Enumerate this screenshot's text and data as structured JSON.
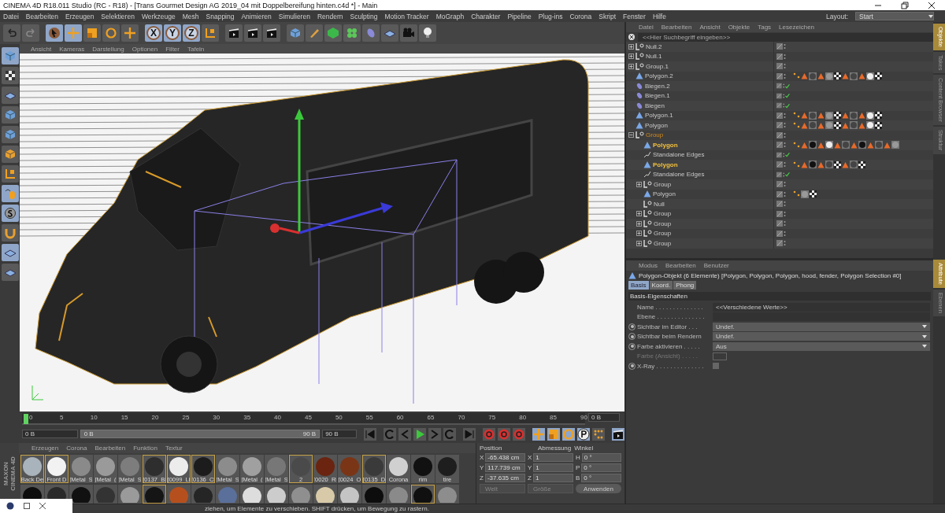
{
  "window": {
    "title": "CINEMA 4D R18.011 Studio (RC - R18) - [Trans Gourmet Design AG 2019_04 mit Doppelbereifung hinten.c4d *] - Main"
  },
  "menu": [
    "Datei",
    "Bearbeiten",
    "Erzeugen",
    "Selektieren",
    "Werkzeuge",
    "Mesh",
    "Snapping",
    "Animieren",
    "Simulieren",
    "Rendern",
    "Sculpting",
    "Motion Tracker",
    "MoGraph",
    "Charakter",
    "Pipeline",
    "Plug-ins",
    "Corona",
    "Skript",
    "Fenster",
    "Hilfe"
  ],
  "layout": {
    "label": "Layout:",
    "value": "Start"
  },
  "toolbar": [
    {
      "kind": "undo",
      "selected": false
    },
    {
      "kind": "redo",
      "selected": false
    },
    {
      "kind": "pointer",
      "selected": true
    },
    {
      "kind": "move",
      "selected": true
    },
    {
      "kind": "scale",
      "selected": false
    },
    {
      "kind": "rotate",
      "selected": false
    },
    {
      "kind": "plus",
      "selected": false
    },
    {
      "kind": "axis-letter",
      "label": "X",
      "selected": true
    },
    {
      "kind": "axis-letter",
      "label": "Y",
      "selected": true
    },
    {
      "kind": "axis-letter",
      "label": "Z",
      "selected": true
    },
    {
      "kind": "coords",
      "selected": false
    },
    {
      "kind": "clapper",
      "selected": false
    },
    {
      "kind": "clapper",
      "selected": false
    },
    {
      "kind": "clapper",
      "selected": false
    },
    {
      "kind": "cube",
      "selected": false
    },
    {
      "kind": "pen",
      "selected": false
    },
    {
      "kind": "subdiv",
      "selected": false
    },
    {
      "kind": "cloner",
      "selected": false
    },
    {
      "kind": "deformer",
      "selected": false
    },
    {
      "kind": "floor",
      "selected": false
    },
    {
      "kind": "camera",
      "selected": false
    },
    {
      "kind": "light",
      "selected": false
    }
  ],
  "viewport": {
    "menu": [
      "Ansicht",
      "Kameras",
      "Darstellung",
      "Optionen",
      "Filter",
      "Tafeln"
    ]
  },
  "side_tools": [
    {
      "kind": "cube",
      "selected": true
    },
    {
      "kind": "checker",
      "selected": false
    },
    {
      "kind": "grid",
      "selected": false
    },
    {
      "kind": "cube",
      "selected": false
    },
    {
      "kind": "cube",
      "selected": false
    },
    {
      "kind": "cube-orange",
      "selected": false
    },
    {
      "kind": "axis",
      "selected": false
    },
    {
      "kind": "mouse",
      "selected": true
    },
    {
      "kind": "snap",
      "selected": true
    },
    {
      "kind": "magnet",
      "selected": false
    },
    {
      "kind": "grid",
      "selected": true
    },
    {
      "kind": "grid",
      "selected": false
    }
  ],
  "timeline": {
    "ticks": [
      "0",
      "5",
      "10",
      "15",
      "20",
      "25",
      "30",
      "35",
      "40",
      "45",
      "50",
      "55",
      "60",
      "65",
      "70",
      "75",
      "80",
      "85",
      "90"
    ],
    "level": 0,
    "current": "0 B",
    "start": "0 B",
    "range": {
      "start": "0 B",
      "end": "90 B",
      "level": 1
    },
    "end": "90 B"
  },
  "playback": [
    {
      "kind": "first",
      "selected": false
    },
    {
      "kind": "loop",
      "selected": false
    },
    {
      "kind": "prev",
      "selected": false
    },
    {
      "kind": "play",
      "selected": false
    },
    {
      "kind": "next",
      "selected": false
    },
    {
      "kind": "loop",
      "selected": false
    },
    {
      "kind": "last",
      "selected": false
    },
    {
      "kind": "record",
      "selected": false
    },
    {
      "kind": "record",
      "selected": false
    },
    {
      "kind": "record",
      "selected": false
    },
    {
      "kind": "move",
      "selected": true
    },
    {
      "kind": "scale",
      "selected": true
    },
    {
      "kind": "rotate",
      "selected": true
    },
    {
      "kind": "p",
      "selected": true
    },
    {
      "kind": "dots",
      "selected": false
    },
    {
      "kind": "film",
      "selected": true
    }
  ],
  "logo": {
    "brand": "MAXON",
    "product": "CINEMA 4D"
  },
  "materials": {
    "menu": [
      "Erzeugen",
      "Corona",
      "Bearbeiten",
      "Funktion",
      "Textur"
    ],
    "items": [
      {
        "name": "Back De",
        "color": "#a9b3bb",
        "selected": true
      },
      {
        "name": "Front D",
        "color": "#f2f2f2",
        "selected": true
      },
      {
        "name": "[Metal_S",
        "color": "#8a8a8a",
        "selected": false
      },
      {
        "name": "[Metal_(",
        "color": "#9a9a9a",
        "selected": false
      },
      {
        "name": "[Metal_S",
        "color": "#7d7d7d",
        "selected": false
      },
      {
        "name": "[0137_Bl",
        "color": "#2e2e2e",
        "selected": true
      },
      {
        "name": "[0099_Li",
        "color": "#ececec",
        "selected": true
      },
      {
        "name": "[0136_Cl",
        "color": "#1c1c1c",
        "selected": true
      },
      {
        "name": "[Metal_S",
        "color": "#8c8c8c",
        "selected": false
      },
      {
        "name": "[Metal_(",
        "color": "#a0a0a0",
        "selected": false
      },
      {
        "name": "[Metal_S",
        "color": "#777777",
        "selected": false
      },
      {
        "name": "2",
        "color": "#4a4a4a",
        "selected": true
      },
      {
        "name": "[0020_Ri",
        "color": "#6a2410",
        "selected": false
      },
      {
        "name": "[0024_O",
        "color": "#7a3516",
        "selected": false
      },
      {
        "name": "[0135_D",
        "color": "#3a3a3a",
        "selected": true
      },
      {
        "name": "Corona",
        "color": "#d0d0d0",
        "selected": false
      },
      {
        "name": "rim",
        "color": "#111111",
        "selected": false
      },
      {
        "name": "tire",
        "color": "#1e1e1e",
        "selected": false
      }
    ],
    "second_row": [
      {
        "color": "#0e0e0e",
        "selected": false
      },
      {
        "color": "#2a2a2a",
        "selected": false
      },
      {
        "color": "#111111",
        "selected": false
      },
      {
        "color": "#333333",
        "selected": false
      },
      {
        "color": "#9a9a9a",
        "selected": false
      },
      {
        "color": "#151515",
        "selected": true
      },
      {
        "color": "#b5501e",
        "selected": false
      },
      {
        "color": "#252525",
        "selected": false
      },
      {
        "color": "#5a6f9a",
        "selected": false
      },
      {
        "color": "#dddddd",
        "selected": false
      },
      {
        "color": "#cccccc",
        "selected": false
      },
      {
        "color": "#8f8f8f",
        "selected": false
      },
      {
        "color": "#d8caa8",
        "selected": false
      },
      {
        "color": "#c4c4c4",
        "selected": false
      },
      {
        "color": "#0d0d0d",
        "selected": false
      },
      {
        "color": "#8a8a8a",
        "selected": false
      },
      {
        "color": "#101010",
        "selected": true
      },
      {
        "color": "#8d8d8d",
        "selected": false
      }
    ]
  },
  "coordinates": {
    "headers": [
      "Position",
      "Abmessung",
      "Winkel"
    ],
    "rows": [
      {
        "axis": "X",
        "position": "-65.438 cm",
        "size_axis": "X",
        "size": "1",
        "angle_axis": "H",
        "angle": "0 °"
      },
      {
        "axis": "Y",
        "position": "117.739 cm",
        "size_axis": "Y",
        "size": "1",
        "angle_axis": "P",
        "angle": "0 °"
      },
      {
        "axis": "Z",
        "position": "-37.635 cm",
        "size_axis": "Z",
        "size": "1",
        "angle_axis": "B",
        "angle": "0 °"
      }
    ],
    "mode": "Welt",
    "size_mode": "Größe",
    "apply": "Anwenden"
  },
  "status_bar": "ziehen, um Elemente zu verschieben. SHIFT drücken, um Bewegung zu rastern.",
  "objects": {
    "menu": [
      "Datei",
      "Bearbeiten",
      "Ansicht",
      "Objekte",
      "Tags",
      "Lesezeichen"
    ],
    "search": {
      "placeholder": "<<Hier Suchbegriff eingeben>>"
    },
    "tree": [
      {
        "name": "Null.2",
        "kind": "null",
        "selected": false,
        "active": false,
        "expanded": false,
        "check": false
      },
      {
        "name": "Null.1",
        "kind": "null",
        "selected": false,
        "active": false,
        "expanded": false,
        "check": false
      },
      {
        "name": "Group.1",
        "kind": "null",
        "selected": false,
        "active": false,
        "expanded": false,
        "check": false
      },
      {
        "name": "Polygon.2",
        "kind": "polygon",
        "selected": false,
        "active": false,
        "check": false,
        "tags": [
          {
            "kind": "points"
          },
          {
            "kind": "triangle"
          },
          {
            "kind": "material",
            "color": "#444444"
          },
          {
            "kind": "triangle"
          },
          {
            "kind": "material",
            "color": "#999999"
          },
          {
            "kind": "checker"
          },
          {
            "kind": "triangle"
          },
          {
            "kind": "material",
            "color": "#444444"
          },
          {
            "kind": "triangle"
          },
          {
            "kind": "material",
            "color": "#eeeeee"
          },
          {
            "kind": "checker"
          }
        ]
      },
      {
        "name": "Biegen.2",
        "kind": "deformer",
        "selected": false,
        "active": false,
        "check": true
      },
      {
        "name": "Biegen.1",
        "kind": "deformer",
        "selected": false,
        "active": false,
        "check": true
      },
      {
        "name": "Biegen",
        "kind": "deformer",
        "selected": false,
        "active": false,
        "check": true
      },
      {
        "name": "Polygon.1",
        "kind": "polygon",
        "selected": false,
        "active": false,
        "check": false,
        "tags": [
          {
            "kind": "points"
          },
          {
            "kind": "triangle"
          },
          {
            "kind": "material",
            "color": "#444444"
          },
          {
            "kind": "triangle"
          },
          {
            "kind": "material",
            "color": "#999999"
          },
          {
            "kind": "checker"
          },
          {
            "kind": "triangle"
          },
          {
            "kind": "material",
            "color": "#444444"
          },
          {
            "kind": "triangle"
          },
          {
            "kind": "material",
            "color": "#eeeeee"
          },
          {
            "kind": "checker"
          }
        ]
      },
      {
        "name": "Polygon",
        "kind": "polygon",
        "selected": false,
        "active": false,
        "check": false,
        "tags": [
          {
            "kind": "points"
          },
          {
            "kind": "triangle"
          },
          {
            "kind": "material",
            "color": "#444444"
          },
          {
            "kind": "triangle"
          },
          {
            "kind": "material",
            "color": "#999999"
          },
          {
            "kind": "checker"
          },
          {
            "kind": "triangle"
          },
          {
            "kind": "material",
            "color": "#444444"
          },
          {
            "kind": "triangle"
          },
          {
            "kind": "material",
            "color": "#eeeeee"
          },
          {
            "kind": "checker"
          }
        ]
      },
      {
        "name": "Group",
        "kind": "null",
        "selected": false,
        "active": true,
        "expanded": true,
        "check": false,
        "children": [
          {
            "name": "Polygon",
            "kind": "polygon",
            "selected": true,
            "active": false,
            "check": false,
            "tags": [
              {
                "kind": "points"
              },
              {
                "kind": "triangle"
              },
              {
                "kind": "material",
                "color": "#111111"
              },
              {
                "kind": "triangle"
              },
              {
                "kind": "material",
                "color": "#eeeeee"
              },
              {
                "kind": "triangle"
              },
              {
                "kind": "material",
                "color": "#444444"
              },
              {
                "kind": "triangle"
              },
              {
                "kind": "material",
                "color": "#111111"
              },
              {
                "kind": "triangle"
              },
              {
                "kind": "material",
                "color": "#444444"
              },
              {
                "kind": "triangle"
              },
              {
                "kind": "material",
                "color": "#999999"
              }
            ]
          },
          {
            "name": "Standalone Edges",
            "kind": "edges",
            "selected": false,
            "active": false,
            "check": true
          },
          {
            "name": "Polygon",
            "kind": "polygon",
            "selected": true,
            "active": false,
            "check": false,
            "tags": [
              {
                "kind": "points"
              },
              {
                "kind": "triangle"
              },
              {
                "kind": "material",
                "color": "#111111"
              },
              {
                "kind": "triangle"
              },
              {
                "kind": "material",
                "color": "#444444"
              },
              {
                "kind": "checker"
              },
              {
                "kind": "triangle"
              },
              {
                "kind": "material",
                "color": "#444444"
              },
              {
                "kind": "checker"
              }
            ]
          },
          {
            "name": "Standalone Edges",
            "kind": "edges",
            "selected": false,
            "active": false,
            "check": true
          },
          {
            "name": "Group",
            "kind": "null",
            "selected": false,
            "active": false,
            "expanded": false,
            "check": false
          },
          {
            "name": "Polygon",
            "kind": "polygon",
            "selected": false,
            "active": false,
            "check": false,
            "tags": [
              {
                "kind": "points"
              },
              {
                "kind": "material",
                "color": "#999999"
              },
              {
                "kind": "checker"
              }
            ]
          },
          {
            "name": "Null",
            "kind": "null",
            "selected": false,
            "active": false,
            "check": false
          },
          {
            "name": "Group",
            "kind": "null",
            "selected": false,
            "active": false,
            "expanded": false,
            "check": false
          },
          {
            "name": "Group",
            "kind": "null",
            "selected": false,
            "active": false,
            "expanded": false,
            "check": false
          },
          {
            "name": "Group",
            "kind": "null",
            "selected": false,
            "active": false,
            "expanded": false,
            "check": false
          },
          {
            "name": "Group",
            "kind": "null",
            "selected": false,
            "active": false,
            "expanded": false,
            "check": false
          }
        ]
      }
    ]
  },
  "attributes": {
    "menu": [
      "Modus",
      "Bearbeiten",
      "Benutzer"
    ],
    "title": "Polygon-Objekt (6 Elemente) [Polygon, Polygon, Polygon, hood, fender, Polygon Selection #0]",
    "tabs": [
      {
        "label": "Basis",
        "selected": true
      },
      {
        "label": "Koord.",
        "selected": false
      },
      {
        "label": "Phong",
        "selected": false
      }
    ],
    "section": "Basis-Eigenschaften",
    "fields": [
      {
        "kind": "text",
        "label": "Name . . . . . . . . . . . . . .",
        "value": "<<Verschiedene Werte>>",
        "animatable": false,
        "disabled": false
      },
      {
        "kind": "link",
        "label": "Ebene . . . . . . . . . . . . . .",
        "animatable": false,
        "disabled": false
      },
      {
        "kind": "select",
        "label": "Sichtbar im Editor . . .",
        "value": "Undef.",
        "animatable": true,
        "disabled": false
      },
      {
        "kind": "select",
        "label": "Sichtbar beim Rendern",
        "value": "Undef.",
        "animatable": true,
        "disabled": false
      },
      {
        "kind": "select",
        "label": "Farbe aktivieren . . . . .",
        "value": "Aus",
        "animatable": true,
        "disabled": false
      },
      {
        "kind": "color",
        "label": "Farbe (Ansicht) . . . . .",
        "animatable": false,
        "disabled": true
      },
      {
        "kind": "checkbox",
        "label": "X-Ray . . . . . . . . . . . . . .",
        "checked": false,
        "animatable": true,
        "disabled": false
      }
    ]
  },
  "side_tabs": [
    {
      "label": "Objekte",
      "selected": true
    },
    {
      "label": "Takes",
      "selected": false
    },
    {
      "label": "Content Browser",
      "selected": false
    },
    {
      "label": "Struktur",
      "selected": false
    }
  ],
  "side_tabs_lower": [
    {
      "label": "Attribute",
      "selected": true
    },
    {
      "label": "Ebenen",
      "selected": false
    }
  ]
}
